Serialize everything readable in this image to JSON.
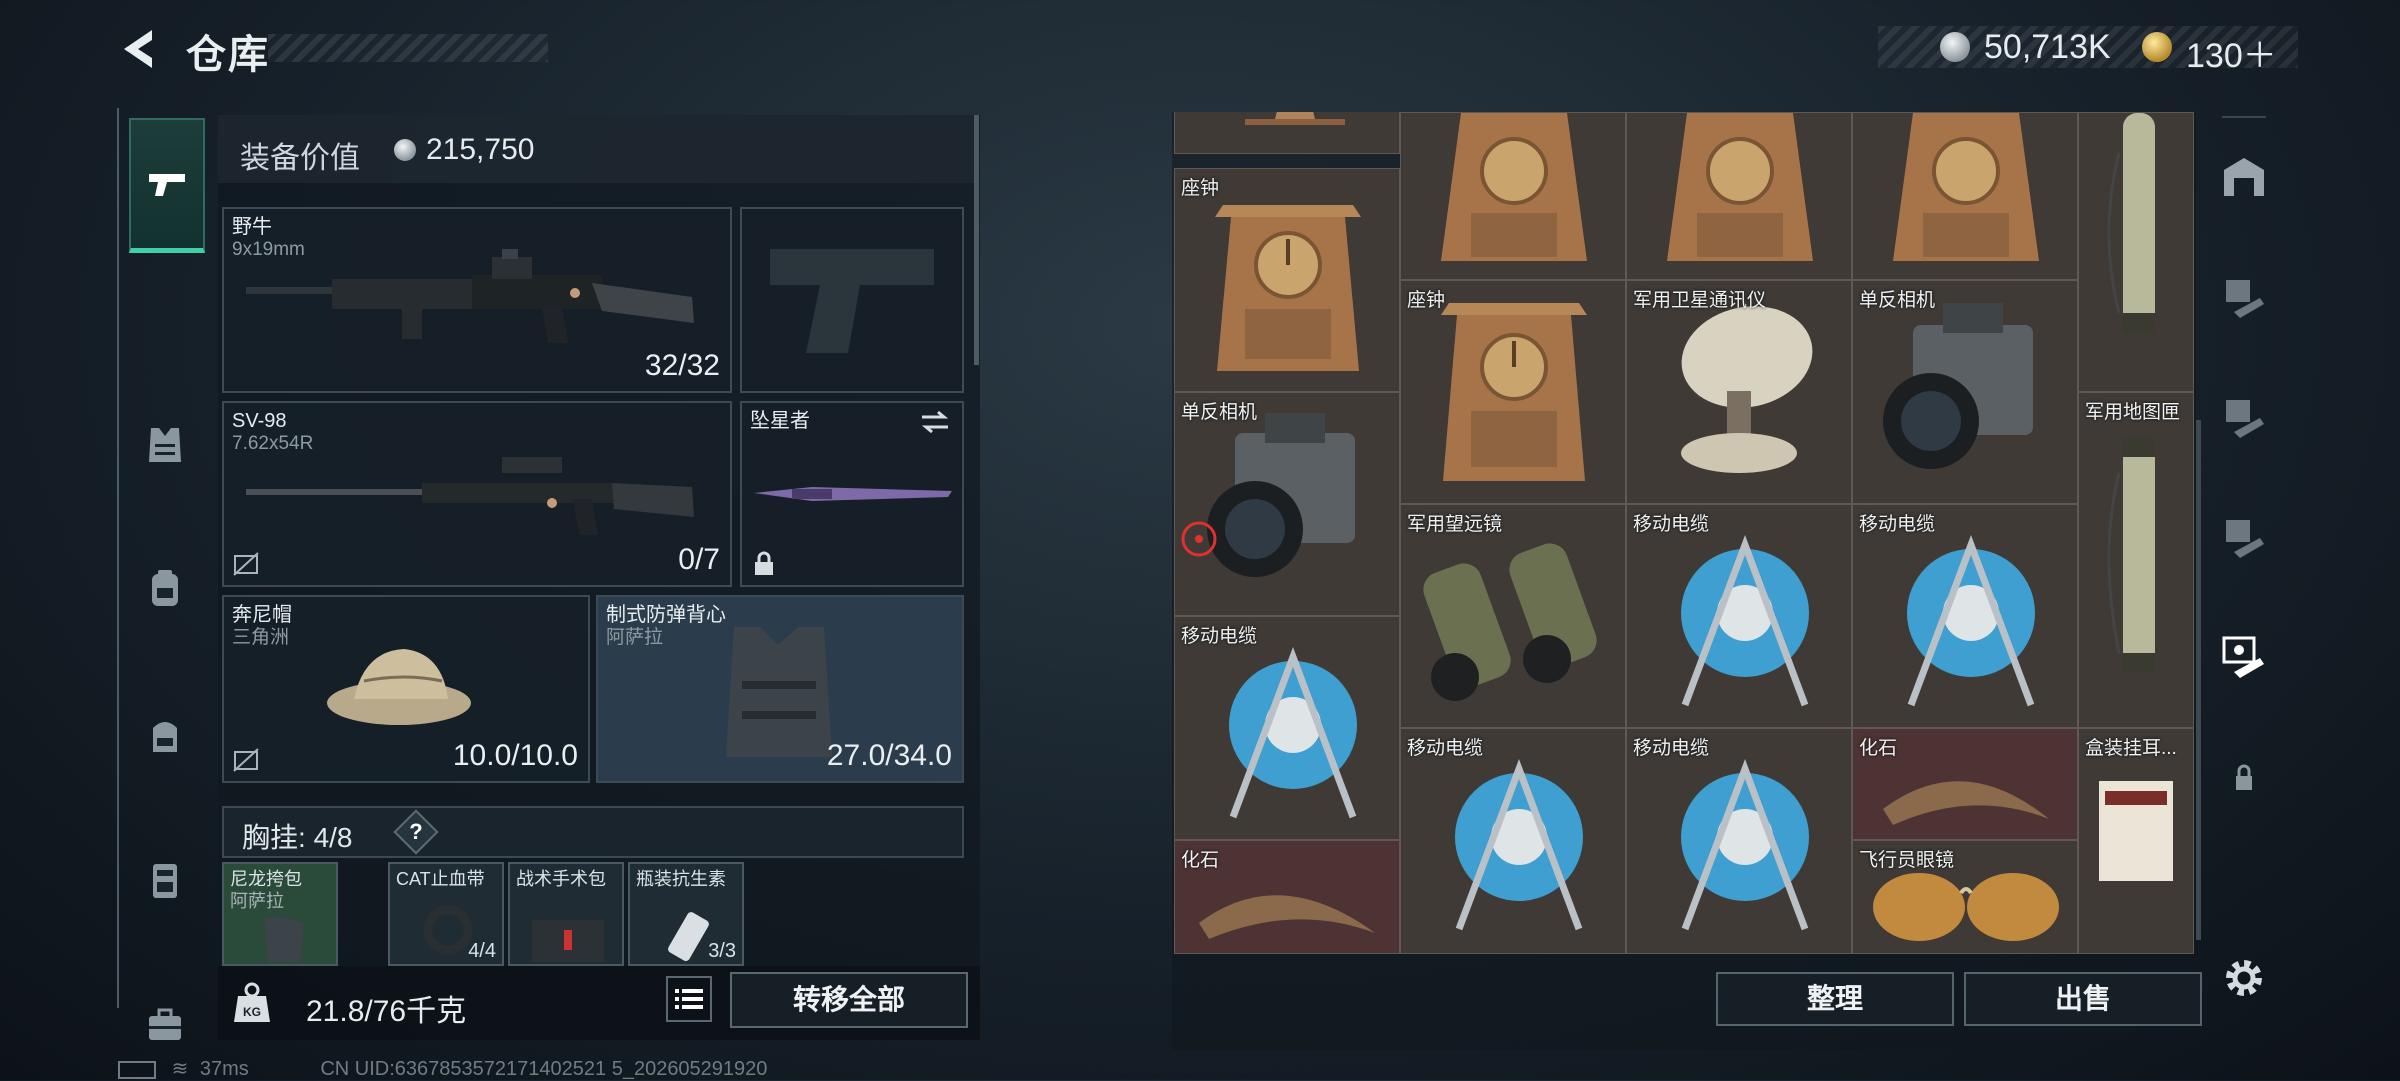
{
  "header": {
    "title": "仓库"
  },
  "currency": {
    "silver": "50,713K",
    "gold": "130＋"
  },
  "left_rail": {
    "tabs": [
      "weapons",
      "vest",
      "helmet",
      "backpack",
      "armor",
      "case"
    ]
  },
  "equipment": {
    "value_label": "装备价值",
    "value": "215,750",
    "primary": {
      "name": "野牛",
      "caliber": "9x19mm",
      "ammo": "32/32"
    },
    "secondary": {
      "name": "SV-98",
      "caliber": "7.62x54R",
      "ammo": "0/7"
    },
    "melee": {
      "name": "坠星者"
    },
    "helmet": {
      "name": "奔尼帽",
      "sub": "三角洲",
      "durability": "10.0/10.0"
    },
    "armor": {
      "name": "制式防弹背心",
      "sub": "阿萨拉",
      "durability": "27.0/34.0"
    },
    "chest": {
      "label": "胸挂",
      "capacity": "4/8",
      "help": "?"
    },
    "chest_items": [
      {
        "name": "尼龙挎包",
        "sub": "阿萨拉"
      },
      {
        "name": "CAT止血带",
        "count": "4/4"
      },
      {
        "name": "战术手术包"
      },
      {
        "name": "瓶装抗生素",
        "count": "3/3"
      }
    ],
    "weight": "21.8/76千克",
    "move_all": "转移全部"
  },
  "status": {
    "ping": "37ms",
    "uid": "CN UID:6367853572171402521 5_202605291920"
  },
  "container": {
    "items": [
      {
        "label": "座钟"
      },
      {
        "label": "座钟"
      },
      {
        "label": "军用卫星通讯仪"
      },
      {
        "label": "单反相机"
      },
      {
        "label": "单反相机"
      },
      {
        "label": "军用地图匣"
      },
      {
        "label": "军用望远镜"
      },
      {
        "label": "移动电缆"
      },
      {
        "label": "移动电缆"
      },
      {
        "label": "移动电缆"
      },
      {
        "label": "移动电缆"
      },
      {
        "label": "移动电缆"
      },
      {
        "label": "化石"
      },
      {
        "label": "盒装挂耳..."
      },
      {
        "label": "化石"
      },
      {
        "label": "飞行员眼镜"
      }
    ],
    "sort": "整理",
    "sell": "出售"
  },
  "colors": {
    "accent": "#3fd1a5",
    "rare_cell": "#4d3334",
    "cell": "#3f3a36"
  }
}
